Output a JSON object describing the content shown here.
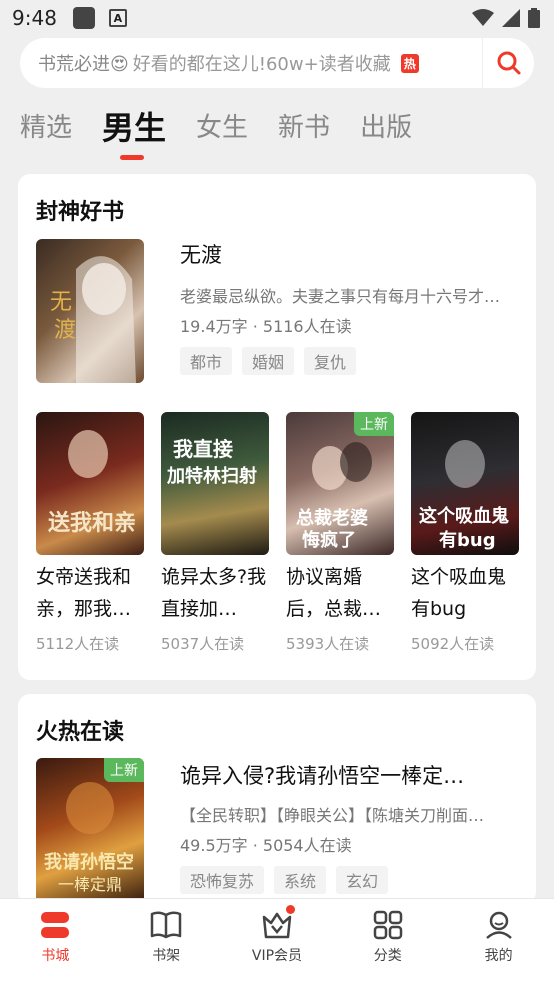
{
  "status": {
    "time": "9:48"
  },
  "search": {
    "lead": "书荒必进😍",
    "text": "好看的都在这儿!60w+读者收藏",
    "hot": "热"
  },
  "tabs": [
    {
      "label": "精选"
    },
    {
      "label": "男生"
    },
    {
      "label": "女生"
    },
    {
      "label": "新书"
    },
    {
      "label": "出版"
    }
  ],
  "section1": {
    "title": "封神好书",
    "feature": {
      "title": "无渡",
      "desc": "老婆最忌纵欲。夫妻之事只有每月十六号才…",
      "meta": "19.4万字 · 5116人在读",
      "tags": [
        "都市",
        "婚姻",
        "复仇"
      ]
    },
    "grid": [
      {
        "title": "女帝送我和亲，那我…",
        "reads": "5112人在读",
        "new": ""
      },
      {
        "title": "诡异太多?我直接加…",
        "reads": "5037人在读",
        "new": ""
      },
      {
        "title": "协议离婚后，总裁…",
        "reads": "5393人在读",
        "new": "上新"
      },
      {
        "title": "这个吸血鬼有bug",
        "reads": "5092人在读",
        "new": ""
      }
    ]
  },
  "section2": {
    "title": "火热在读",
    "item": {
      "title": "诡异入侵?我请孙悟空一棒定…",
      "desc": "【全民转职】【睁眼关公】【陈塘关刀削面…",
      "meta": "49.5万字 · 5054人在读",
      "tags": [
        "恐怖复苏",
        "系统",
        "玄幻"
      ],
      "new": "上新"
    }
  },
  "nav": [
    {
      "label": "书城"
    },
    {
      "label": "书架"
    },
    {
      "label": "VIP会员"
    },
    {
      "label": "分类"
    },
    {
      "label": "我的"
    }
  ],
  "colors": {
    "accent": "#ef3a2b",
    "new_badge": "#5bb85d"
  }
}
